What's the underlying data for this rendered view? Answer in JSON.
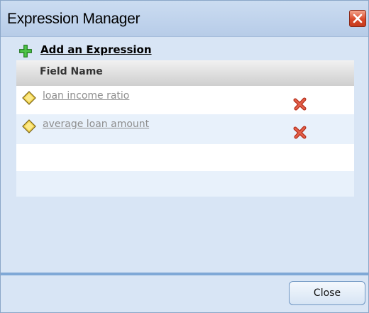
{
  "dialog": {
    "title": "Expression Manager"
  },
  "toolbar": {
    "add_label": "Add an Expression"
  },
  "table": {
    "column_header": "Field Name",
    "rows": [
      {
        "name": "loan income ratio",
        "icon": "diamond-icon",
        "delete_icon": "red-x-icon"
      },
      {
        "name": "average loan amount",
        "icon": "diamond-icon",
        "delete_icon": "red-x-icon"
      }
    ]
  },
  "footer": {
    "close_label": "Close"
  }
}
